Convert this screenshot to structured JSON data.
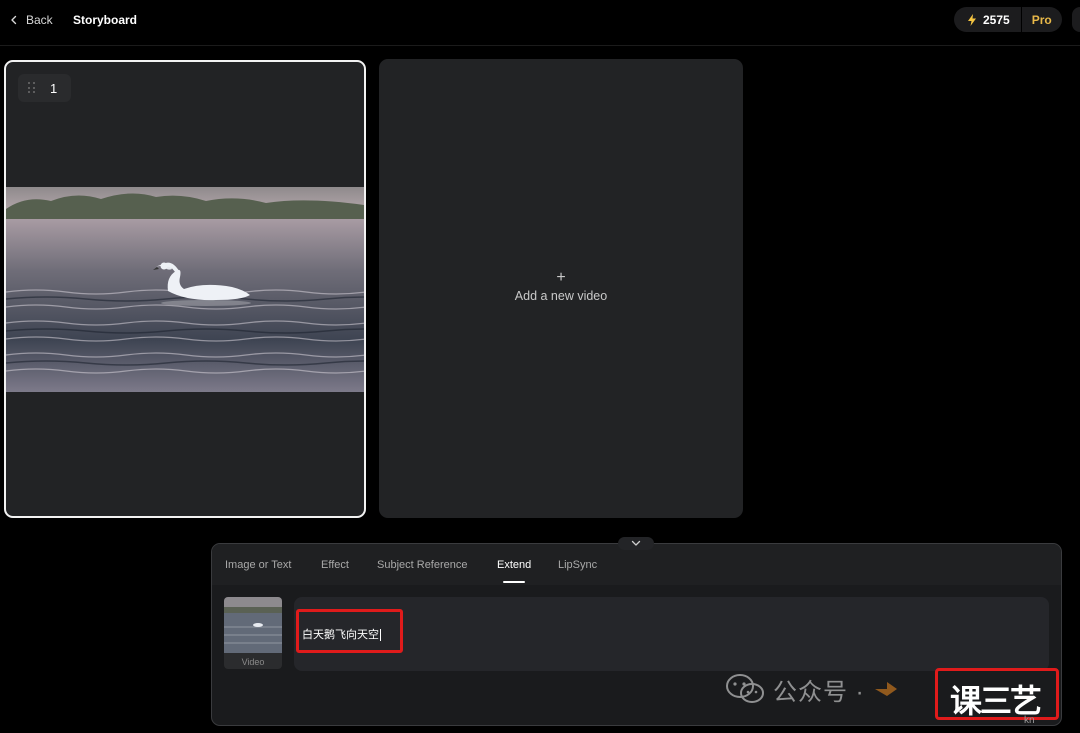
{
  "header": {
    "back_label": "Back",
    "title": "Storyboard",
    "credits": "2575",
    "plan_badge": "Pro"
  },
  "storyboard": {
    "clips": [
      {
        "index": "1"
      }
    ],
    "add_video_plus": "+",
    "add_video_label": "Add a new video"
  },
  "panel": {
    "tabs": [
      {
        "label": "Image or Text"
      },
      {
        "label": "Effect"
      },
      {
        "label": "Subject Reference"
      },
      {
        "label": "Extend",
        "active": true
      },
      {
        "label": "LipSync"
      }
    ],
    "thumbnail_label": "Video",
    "prompt_value": "白天鹅飞向天空"
  },
  "watermark": {
    "text": "公众号 ·",
    "big_text": "课三艺",
    "site": "kn"
  },
  "colors": {
    "accent_pro": "#e9b949",
    "highlight_red": "#e01b1b",
    "bolt": "#f5c542"
  },
  "icons": {
    "back": "chevron-left-icon",
    "credits": "lightning-icon",
    "collapse": "chevron-down-icon",
    "drag": "drag-handle-icon"
  }
}
